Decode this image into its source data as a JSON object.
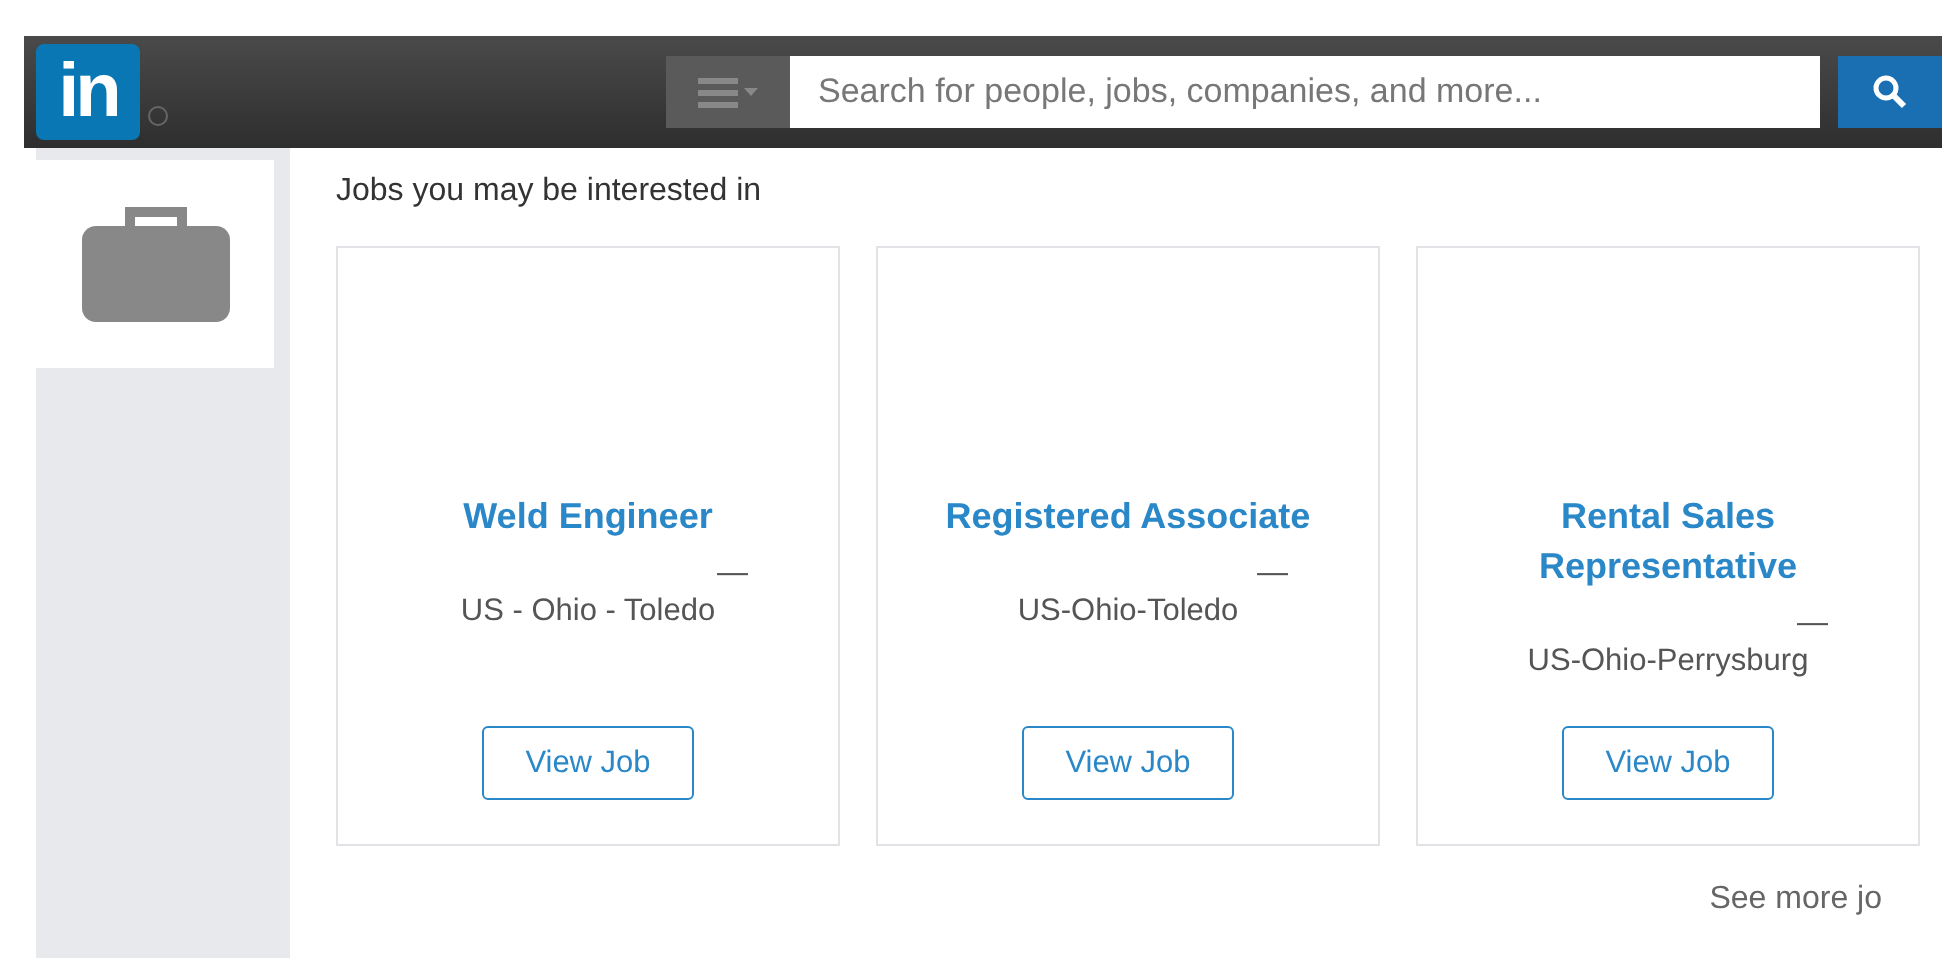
{
  "header": {
    "logo": "in",
    "search": {
      "placeholder": "Search for people, jobs, companies, and more..."
    }
  },
  "section_title": "Jobs you may be interested in",
  "jobs": [
    {
      "title": "Weld Engineer",
      "separator": "—",
      "location": "US - Ohio - Toledo",
      "button": "View Job"
    },
    {
      "title": "Registered Associate",
      "separator": "—",
      "location": "US-Ohio-Toledo",
      "button": "View Job"
    },
    {
      "title": "Rental Sales Representative",
      "separator": "—",
      "location": "US-Ohio-Perrysburg",
      "button": "View Job"
    }
  ],
  "see_more": "See more jo"
}
